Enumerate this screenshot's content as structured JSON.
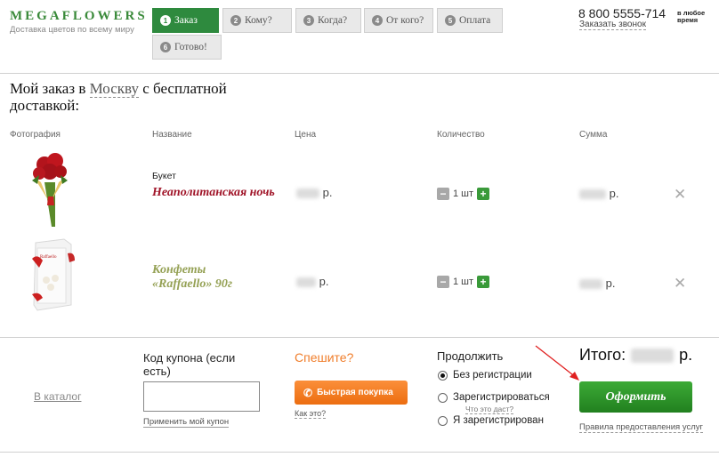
{
  "header": {
    "logo_name": "MEGAFLOWERS",
    "logo_tagline": "Доставка цветов по всему миру",
    "steps": [
      {
        "num": "1",
        "label": "Заказ",
        "active": true
      },
      {
        "num": "2",
        "label": "Кому?",
        "active": false
      },
      {
        "num": "3",
        "label": "Когда?",
        "active": false
      },
      {
        "num": "4",
        "label": "От кого?",
        "active": false
      },
      {
        "num": "5",
        "label": "Оплата",
        "active": false
      },
      {
        "num": "6",
        "label": "Готово!",
        "active": false
      }
    ],
    "phone": "8 800 5555-714",
    "callback_link": "Заказать звонок",
    "anytime_text": "в любое время"
  },
  "order": {
    "title_before": "Мой заказ в ",
    "city": "Москву",
    "title_after": " с бесплатной доставкой:",
    "columns": {
      "photo": "Фотография",
      "name": "Название",
      "price": "Цена",
      "quantity": "Количество",
      "sum": "Сумма"
    },
    "items": [
      {
        "category": "Букет",
        "name": "Неаполитанская ночь",
        "price_unit": "р.",
        "qty": "1 шт",
        "sum_unit": "р."
      },
      {
        "category": "",
        "name": "Конфеты «Raffaello» 90г",
        "price_unit": "р.",
        "qty": "1 шт",
        "sum_unit": "р."
      }
    ]
  },
  "footer": {
    "catalog_link": "В каталог",
    "coupon_label": "Код купона (если есть)",
    "coupon_value": "",
    "coupon_apply": "Применить мой купон",
    "hurry": "Спешите?",
    "quick_buy": "Быстрая покупка",
    "how_link": "Как это?",
    "continue_label": "Продолжить",
    "options": [
      {
        "label": "Без регистрации",
        "selected": true
      },
      {
        "label": "Зарегистрироваться",
        "selected": false
      },
      {
        "label": "Я зарегистрирован",
        "selected": false
      }
    ],
    "what_is_link": "Что это даст?",
    "total_label": "Итого:",
    "total_unit": "р.",
    "order_button": "Оформить",
    "rules_link": "Правила предоставления услуг"
  },
  "colors": {
    "brand_green": "#2e8a3e",
    "product_red": "#a01428",
    "product_olive": "#95a155",
    "accent_orange": "#f07d2a"
  }
}
